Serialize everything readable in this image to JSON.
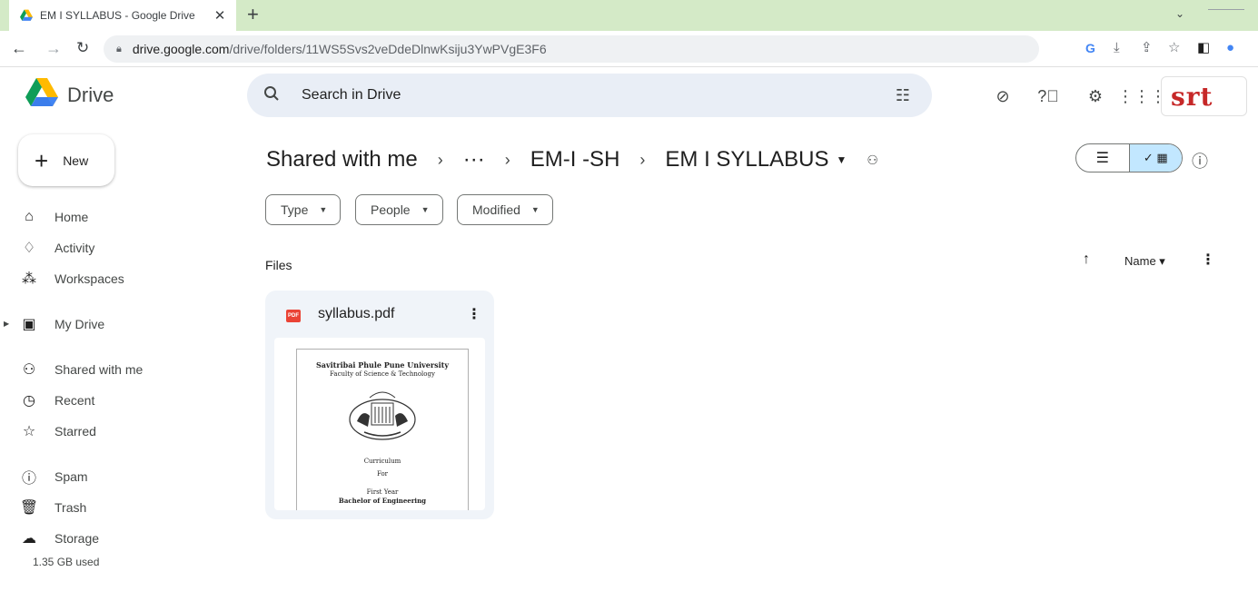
{
  "browser": {
    "tab_title": "EM I SYLLABUS - Google Drive",
    "close_glyph": "✕",
    "new_tab_glyph": "+",
    "url_host": "drive.google.com",
    "url_path": "/drive/folders/11WS5Svs2veDdeDlnwKsiju3YwPVgE3F6"
  },
  "drive": {
    "app_name": "Drive",
    "search_placeholder": "Search in Drive"
  },
  "account": {
    "brand_text": "srt"
  },
  "sidebar": {
    "new_label": "New",
    "items": [
      {
        "label": "Home",
        "icon": "home-icon"
      },
      {
        "label": "Activity",
        "icon": "bell-icon"
      },
      {
        "label": "Workspaces",
        "icon": "workspaces-icon"
      },
      {
        "label": "My Drive",
        "icon": "my-drive-icon"
      },
      {
        "label": "Shared with me",
        "icon": "people-icon"
      },
      {
        "label": "Recent",
        "icon": "clock-icon"
      },
      {
        "label": "Starred",
        "icon": "star-icon"
      },
      {
        "label": "Spam",
        "icon": "spam-icon"
      },
      {
        "label": "Trash",
        "icon": "trash-icon"
      },
      {
        "label": "Storage",
        "icon": "cloud-icon"
      }
    ],
    "storage_used": "1.35 GB used"
  },
  "main": {
    "breadcrumb": [
      "Shared with me",
      "···",
      "EM-I -SH",
      "EM I SYLLABUS"
    ],
    "filters": [
      "Type",
      "People",
      "Modified"
    ],
    "section_label": "Files",
    "sort_label": "Name"
  },
  "files": [
    {
      "name": "syllabus.pdf",
      "type_badge": "PDF",
      "preview": {
        "line1": "Savitribai Phule Pune University",
        "line2": "Faculty of Science & Technology",
        "line3": "Curriculum",
        "line4": "For",
        "line5": "First Year",
        "line6": "Bachelor of Engineering"
      }
    }
  ],
  "colors": {
    "tabstrip": "#d4eac7",
    "search_bg": "#e9eef6",
    "view_toggle_active": "#c2e7ff",
    "pdf_red": "#ea4335",
    "brand_red": "#c62828"
  }
}
